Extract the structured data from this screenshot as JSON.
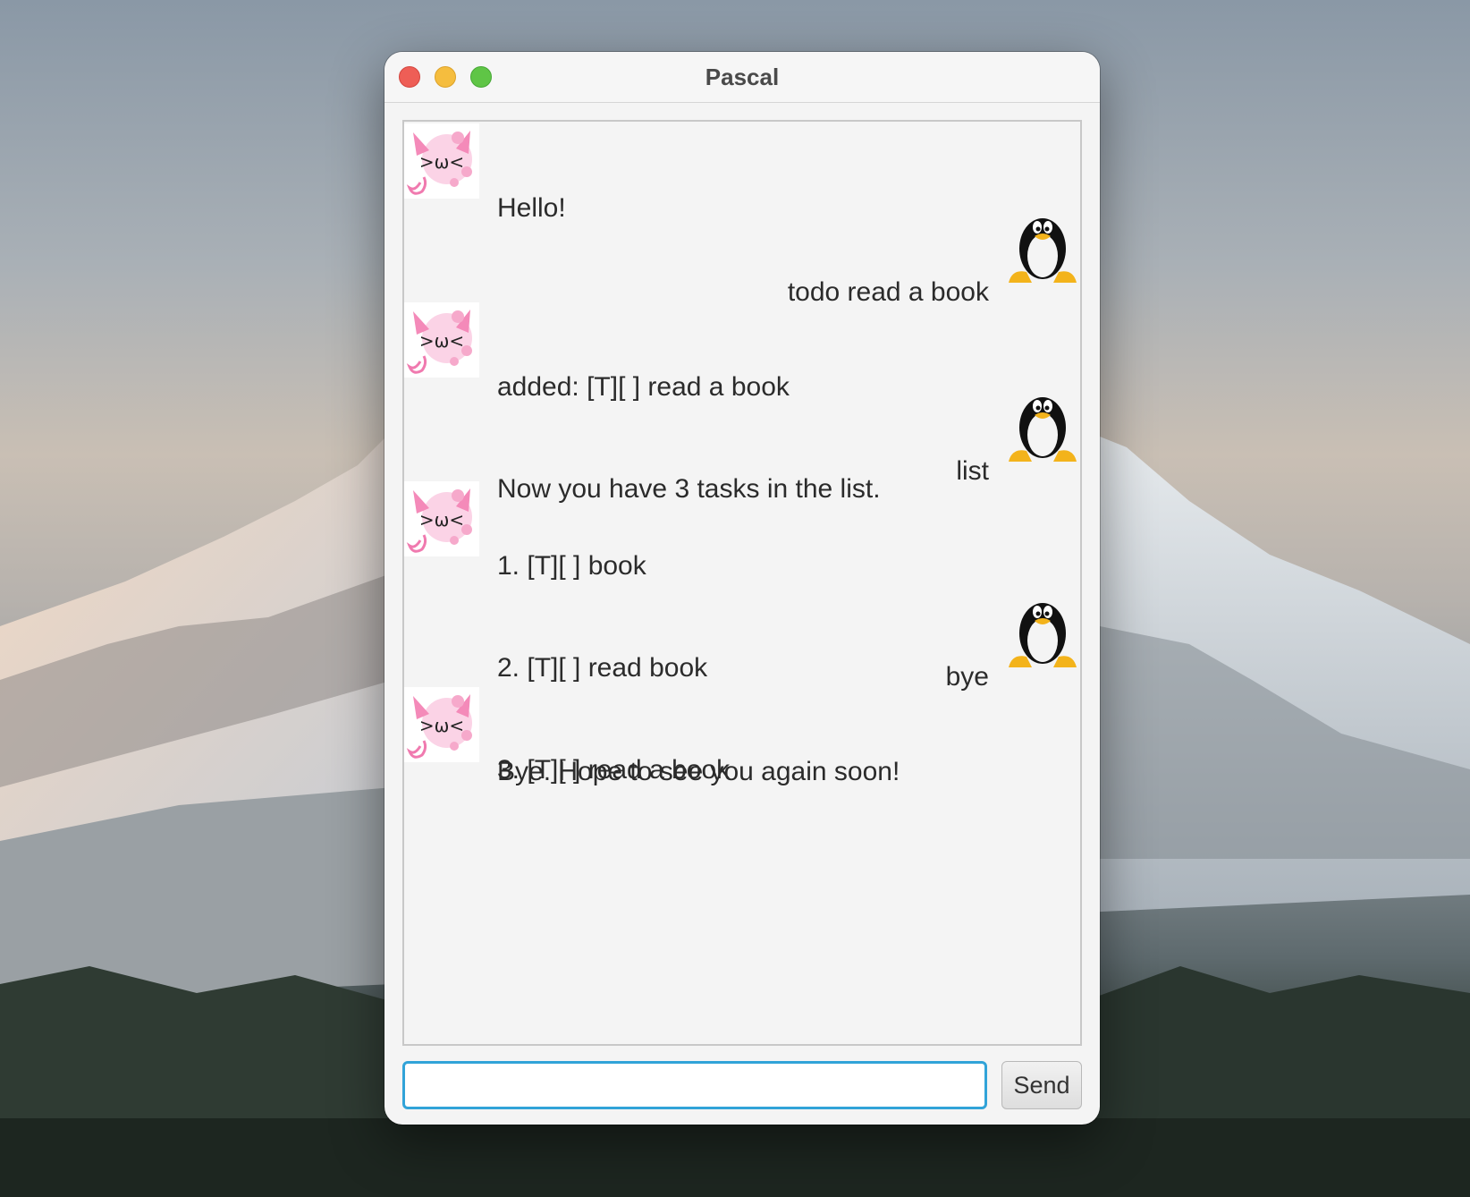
{
  "window": {
    "title": "Pascal"
  },
  "chat": {
    "messages": [
      {
        "sender": "duke",
        "lines": [
          "Hello!"
        ]
      },
      {
        "sender": "user",
        "lines": [
          "todo read a book"
        ]
      },
      {
        "sender": "duke",
        "lines": [
          "added: [T][ ] read a book",
          "Now you have 3 tasks in the list."
        ]
      },
      {
        "sender": "user",
        "lines": [
          "list"
        ]
      },
      {
        "sender": "duke",
        "lines": [
          "1. [T][ ] book",
          "2. [T][ ] read book",
          "3. [T][ ] read a book"
        ]
      },
      {
        "sender": "user",
        "lines": [
          "bye"
        ]
      },
      {
        "sender": "duke",
        "lines": [
          "Bye. Hope to see you again soon!"
        ]
      }
    ],
    "duke_avatar_icon": "pink-cat-face-icon",
    "user_avatar_icon": "tux-penguin-icon"
  },
  "input": {
    "value": "",
    "placeholder": "",
    "send_label": "Send"
  },
  "colors": {
    "focus_ring": "#31a3d8",
    "close": "#ee5e56",
    "minimize": "#f5bd3e",
    "maximize": "#5fc546"
  }
}
